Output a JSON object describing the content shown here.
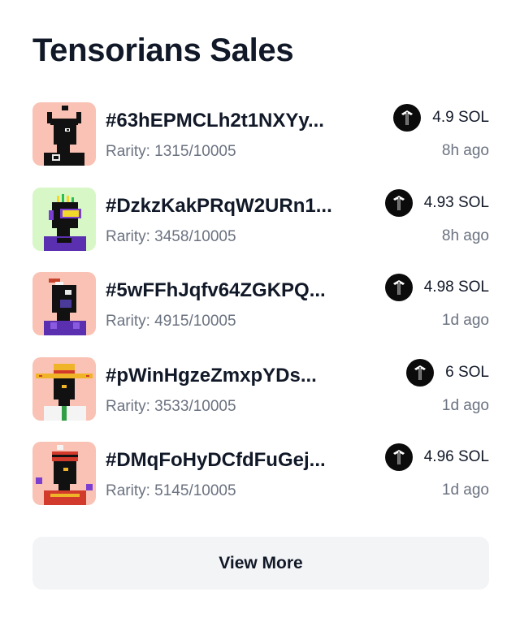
{
  "header": {
    "title": "Tensorians Sales"
  },
  "sales": [
    {
      "name": "#63hEPMCLh2t1NXYy...",
      "rarity": "Rarity: 1315/10005",
      "price": "4.9 SOL",
      "time": "8h ago",
      "bg": "#f9c2b4",
      "icon": "tensor-logo-icon"
    },
    {
      "name": "#DzkzKakPRqW2URn1...",
      "rarity": "Rarity: 3458/10005",
      "price": "4.93 SOL",
      "time": "8h ago",
      "bg": "#d7f7c6",
      "icon": "tensor-logo-icon"
    },
    {
      "name": "#5wFFhJqfv64ZGKPQ...",
      "rarity": "Rarity: 4915/10005",
      "price": "4.98 SOL",
      "time": "1d ago",
      "bg": "#f9c2b4",
      "icon": "tensor-logo-icon"
    },
    {
      "name": "#pWinHgzeZmxpYDs...",
      "rarity": "Rarity: 3533/10005",
      "price": "6 SOL",
      "time": "1d ago",
      "bg": "#f9c2b4",
      "icon": "tensor-logo-icon"
    },
    {
      "name": "#DMqFoHyDCfdFuGej...",
      "rarity": "Rarity: 5145/10005",
      "price": "4.96 SOL",
      "time": "1d ago",
      "bg": "#f9c2b4",
      "icon": "tensor-logo-icon"
    }
  ],
  "footer": {
    "view_more_label": "View More"
  }
}
